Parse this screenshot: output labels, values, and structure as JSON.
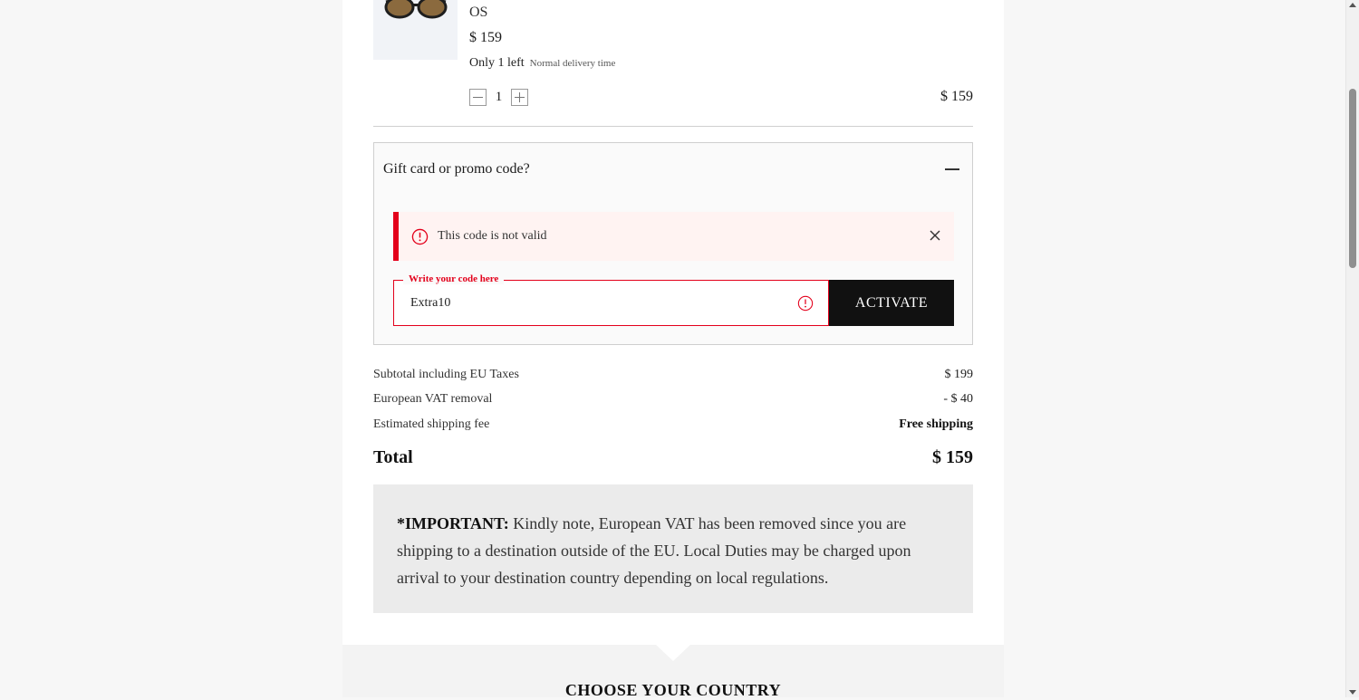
{
  "product": {
    "size": "OS",
    "unit_price": "$ 159",
    "stock": "Only 1 left",
    "delivery": "Normal delivery time",
    "quantity": "1",
    "line_price": "$ 159"
  },
  "promo": {
    "title": "Gift card or promo code?",
    "error": "This code is not valid",
    "field_label": "Write your code here",
    "field_value": "Extra10",
    "activate_label": "ACTIVATE"
  },
  "summary": {
    "subtotal_label": "Subtotal including EU Taxes",
    "subtotal_value": "$ 199",
    "vat_label": "European VAT removal",
    "vat_value": "- $ 40",
    "shipping_label": "Estimated shipping fee",
    "shipping_value": "Free shipping",
    "total_label": "Total",
    "total_value": "$ 159"
  },
  "notice": {
    "heading": "*IMPORTANT:",
    "body": " Kindly note, European VAT has been removed since you are shipping to a destination outside of the EU. Local Duties may be charged upon arrival to your destination country depending on local regulations."
  },
  "country": {
    "title": "CHOOSE YOUR COUNTRY"
  },
  "colors": {
    "error": "#e3001b",
    "button": "#111111",
    "notice_bg": "#ebebeb"
  },
  "icons": [
    "sunglasses-image",
    "minus-icon",
    "plus-icon",
    "collapse-icon",
    "error-icon",
    "close-icon"
  ]
}
